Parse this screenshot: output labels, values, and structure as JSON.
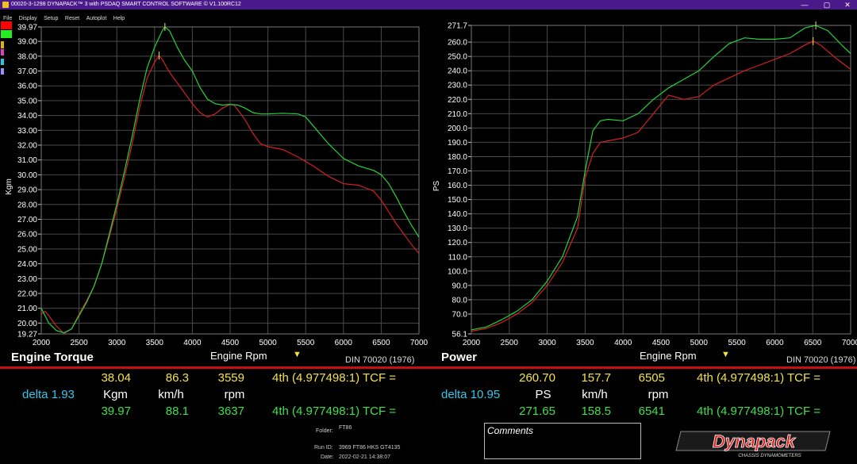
{
  "window": {
    "title": "00020-3-1298 DYNAPACK™ 3 with PSDAQ SMART CONTROL SOFTWARE © V1.100RC12",
    "controls": {
      "minimize": "—",
      "maximize": "▢",
      "close": "✕"
    }
  },
  "menu": [
    "File",
    "Display",
    "Setup",
    "Reset",
    "Autoplot",
    "Help"
  ],
  "swatch_colors": [
    "#ff0000",
    "#22ee22",
    "#e8b000",
    "#e040c0",
    "#20c8e8",
    "#9a90ff"
  ],
  "colors": {
    "run1": "#d42020",
    "run2": "#22d43a",
    "marker": "#f2e24a",
    "accent_line": "#c61010"
  },
  "chart_data": [
    {
      "type": "line",
      "ylabel": "Kgm",
      "xlabel_selector": "Engine Rpm",
      "title": "Engine Torque",
      "standard": "DIN 70020 (1976)",
      "xlim": [
        2000,
        7000
      ],
      "ylim": [
        19.27,
        39.97
      ],
      "x_ticks": [
        "2000",
        "2500",
        "3000",
        "3500",
        "4000",
        "4500",
        "5000",
        "5500",
        "6000",
        "6500",
        "7000"
      ],
      "y_ticks": [
        "39.97",
        "39.00",
        "38.00",
        "37.00",
        "36.00",
        "35.00",
        "34.00",
        "33.00",
        "32.00",
        "31.00",
        "30.00",
        "29.00",
        "28.00",
        "27.00",
        "26.00",
        "25.00",
        "24.00",
        "23.00",
        "22.00",
        "21.00",
        "20.00",
        "19.27"
      ],
      "grid": true,
      "series": [
        {
          "color": "#d42020",
          "x": [
            2000,
            2050,
            2100,
            2200,
            2300,
            2400,
            2500,
            2600,
            2700,
            2800,
            2900,
            3000,
            3100,
            3200,
            3300,
            3400,
            3500,
            3559,
            3600,
            3700,
            3800,
            3900,
            4000,
            4100,
            4200,
            4300,
            4400,
            4500,
            4550,
            4600,
            4700,
            4800,
            4900,
            5000,
            5200,
            5400,
            5600,
            5800,
            6000,
            6200,
            6400,
            6500,
            6600,
            6700,
            6800,
            6900,
            7000
          ],
          "y": [
            20.6,
            20.8,
            20.5,
            19.8,
            19.3,
            19.6,
            20.6,
            21.5,
            22.5,
            24.0,
            25.8,
            27.7,
            29.8,
            32.0,
            34.5,
            36.5,
            37.6,
            38.04,
            37.8,
            36.9,
            36.2,
            35.5,
            34.8,
            34.2,
            33.9,
            34.1,
            34.5,
            34.75,
            34.7,
            34.4,
            33.7,
            32.8,
            32.1,
            31.9,
            31.7,
            31.2,
            30.6,
            29.9,
            29.4,
            29.3,
            28.9,
            28.3,
            27.5,
            26.7,
            26.0,
            25.3,
            24.7
          ]
        },
        {
          "color": "#22d43a",
          "x": [
            2000,
            2050,
            2100,
            2200,
            2300,
            2400,
            2500,
            2600,
            2700,
            2800,
            2900,
            3000,
            3100,
            3200,
            3300,
            3400,
            3500,
            3600,
            3637,
            3700,
            3800,
            3900,
            4000,
            4100,
            4200,
            4300,
            4400,
            4500,
            4600,
            4700,
            4800,
            4900,
            5000,
            5200,
            5400,
            5500,
            5600,
            5800,
            6000,
            6200,
            6400,
            6500,
            6600,
            6700,
            6800,
            6900,
            7000
          ],
          "y": [
            21.0,
            20.5,
            20.0,
            19.5,
            19.35,
            19.6,
            20.5,
            21.4,
            22.5,
            24.0,
            26.0,
            28.0,
            30.2,
            32.5,
            35.0,
            37.2,
            38.6,
            39.7,
            39.97,
            39.7,
            38.6,
            37.7,
            37.0,
            35.9,
            35.1,
            34.8,
            34.7,
            34.75,
            34.7,
            34.5,
            34.2,
            34.1,
            34.1,
            34.15,
            34.1,
            33.9,
            33.3,
            32.1,
            31.1,
            30.6,
            30.3,
            30.0,
            29.4,
            28.5,
            27.5,
            26.6,
            25.8
          ]
        }
      ],
      "readout": {
        "run1": {
          "value": "38.04",
          "speed": "86.3",
          "rpm": "3559",
          "gear": "4th (4.977498:1) TCF ="
        },
        "delta": "delta 1.93",
        "units": {
          "value": "Kgm",
          "speed": "km/h",
          "rpm": "rpm"
        },
        "run2": {
          "value": "39.97",
          "speed": "88.1",
          "rpm": "3637",
          "gear": "4th (4.977498:1) TCF ="
        }
      }
    },
    {
      "type": "line",
      "ylabel": "PS",
      "xlabel_selector": "Engine Rpm",
      "title": "Power",
      "standard": "DIN 70020 (1976)",
      "xlim": [
        2000,
        7000
      ],
      "ylim": [
        56.1,
        271.7
      ],
      "x_ticks": [
        "2000",
        "2500",
        "3000",
        "3500",
        "4000",
        "4500",
        "5000",
        "5500",
        "6000",
        "6500",
        "7000"
      ],
      "y_ticks": [
        "271.7",
        "260.0",
        "250.0",
        "240.0",
        "230.0",
        "220.0",
        "210.0",
        "200.0",
        "190.0",
        "180.0",
        "170.0",
        "160.0",
        "150.0",
        "140.0",
        "130.0",
        "120.0",
        "110.0",
        "100.0",
        "90.0",
        "80.0",
        "70.0",
        "56.1"
      ],
      "grid": true,
      "series": [
        {
          "color": "#d42020",
          "x": [
            2000,
            2200,
            2400,
            2600,
            2800,
            3000,
            3200,
            3400,
            3500,
            3600,
            3700,
            3800,
            4000,
            4200,
            4400,
            4600,
            4800,
            5000,
            5200,
            5400,
            5600,
            5800,
            6000,
            6200,
            6400,
            6505,
            6600,
            6800,
            7000
          ],
          "y": [
            58,
            60,
            64,
            70,
            78,
            90,
            106,
            130,
            165,
            182,
            190,
            191,
            193,
            197,
            210,
            223,
            220,
            222,
            230,
            235,
            240,
            244,
            248,
            252,
            258,
            260.7,
            258,
            249,
            241
          ]
        },
        {
          "color": "#22d43a",
          "x": [
            2000,
            2200,
            2400,
            2600,
            2800,
            3000,
            3200,
            3400,
            3500,
            3600,
            3700,
            3800,
            4000,
            4200,
            4400,
            4600,
            4800,
            5000,
            5200,
            5400,
            5600,
            5800,
            6000,
            6200,
            6400,
            6541,
            6700,
            6900,
            7000
          ],
          "y": [
            59,
            61,
            66,
            72,
            80,
            93,
            110,
            138,
            170,
            198,
            205,
            206,
            205,
            210,
            220,
            228,
            234,
            240,
            250,
            259,
            263,
            262,
            262,
            263,
            270,
            271.65,
            268,
            257,
            252
          ]
        }
      ],
      "readout": {
        "run1": {
          "value": "260.70",
          "speed": "157.7",
          "rpm": "6505",
          "gear": "4th (4.977498:1) TCF ="
        },
        "delta": "delta 10.95",
        "units": {
          "value": "PS",
          "speed": "km/h",
          "rpm": "rpm"
        },
        "run2": {
          "value": "271.65",
          "speed": "158.5",
          "rpm": "6541",
          "gear": "4th (4.977498:1) TCF ="
        }
      }
    }
  ],
  "info": {
    "folder_label": "Folder:",
    "folder_value": "FT86",
    "runid_label": "Run ID:",
    "runid_value": "3969 FT86 HKS GT4135",
    "date_label": "Date:",
    "date_value": "2022-02-21 14:38:07"
  },
  "comments_label": "Comments",
  "logo": {
    "main": "Dynapack",
    "sub": "CHASSIS DYNAMOMETERS"
  }
}
